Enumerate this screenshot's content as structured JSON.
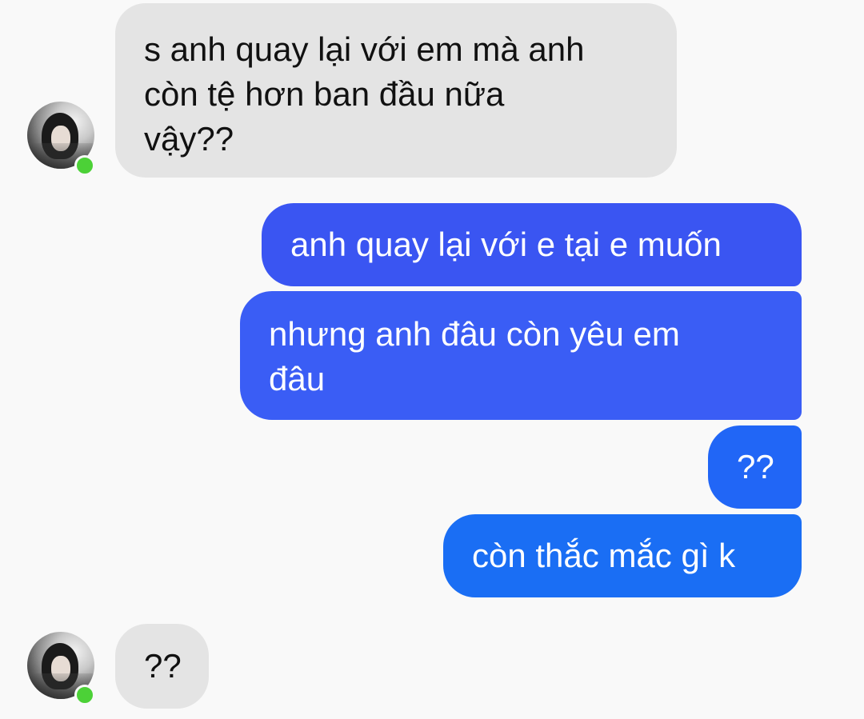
{
  "colors": {
    "background": "#f9f9f9",
    "incoming_bubble": "#e4e4e4",
    "outgoing_gradient": [
      "#3a55f2",
      "#3a5df5",
      "#2166f6",
      "#1a6ef4"
    ],
    "online_indicator": "#4cd137"
  },
  "messages": [
    {
      "direction": "incoming",
      "lines": [
        "s anh quay lại với em mà anh",
        "còn tệ hơn ban đầu nữa",
        "vậy??"
      ]
    },
    {
      "direction": "outgoing",
      "lines": [
        "anh quay lại với e tại e muốn"
      ]
    },
    {
      "direction": "outgoing",
      "lines": [
        "nhưng anh đâu còn yêu em",
        "đâu"
      ]
    },
    {
      "direction": "outgoing",
      "lines": [
        "??"
      ]
    },
    {
      "direction": "outgoing",
      "lines": [
        "còn thắc mắc gì k"
      ]
    },
    {
      "direction": "incoming",
      "lines": [
        "??"
      ]
    }
  ],
  "contact": {
    "avatar_icon": "profile-photo-icon",
    "status_icon": "online-dot-icon"
  }
}
